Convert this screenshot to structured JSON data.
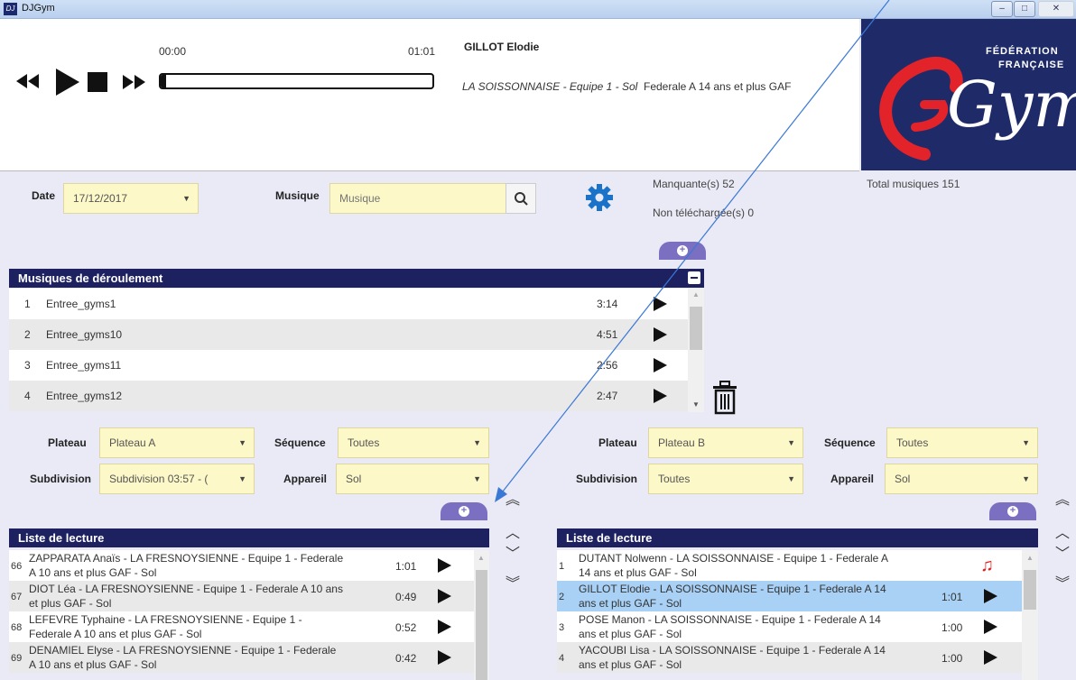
{
  "window": {
    "title": "DJGym",
    "minimize": "–",
    "maximize": "□",
    "close": "✕"
  },
  "player": {
    "current_time": "00:00",
    "duration": "01:01",
    "progress": 0.02,
    "artist": "GILLOT Elodie",
    "club_team": "LA SOISSONNAISE - Equipe 1 - Sol",
    "category": "Federale A 14 ans et plus GAF"
  },
  "logo": {
    "line1": "FÉDÉRATION",
    "line2": "FRANÇAISE",
    "word": "Gym"
  },
  "filters": {
    "date_label": "Date",
    "date_value": "17/12/2017",
    "music_label": "Musique",
    "music_placeholder": "Musique",
    "missing": "Manquante(s) 52",
    "not_downloaded": "Non téléchargée(s) 0",
    "total": "Total musiques 151"
  },
  "deroulement": {
    "title": "Musiques de déroulement",
    "rows": [
      {
        "num": "1",
        "name": "Entree_gyms1",
        "duration": "3:14"
      },
      {
        "num": "2",
        "name": "Entree_gyms10",
        "duration": "4:51"
      },
      {
        "num": "3",
        "name": "Entree_gyms11",
        "duration": "2:56"
      },
      {
        "num": "4",
        "name": "Entree_gyms12",
        "duration": "2:47"
      }
    ]
  },
  "left": {
    "plateau_label": "Plateau",
    "plateau_value": "Plateau A",
    "sequence_label": "Séquence",
    "sequence_value": "Toutes",
    "subdivision_label": "Subdivision",
    "subdivision_value": "Subdivision 03:57 - (",
    "appareil_label": "Appareil",
    "appareil_value": "Sol",
    "list_title": "Liste de lecture",
    "rows": [
      {
        "num": "66",
        "l1": "ZAPPARATA Anaïs - LA FRESNOYSIENNE - Equipe 1 - Federale",
        "l2": "A 10 ans et plus GAF - Sol",
        "duration": "1:01"
      },
      {
        "num": "67",
        "l1": "DIOT Léa - LA FRESNOYSIENNE - Equipe 1 - Federale A 10 ans",
        "l2": "et plus GAF - Sol",
        "duration": "0:49"
      },
      {
        "num": "68",
        "l1": "LEFEVRE Typhaine - LA FRESNOYSIENNE - Equipe 1 -",
        "l2": "Federale A 10 ans et plus GAF - Sol",
        "duration": "0:52"
      },
      {
        "num": "69",
        "l1": "DENAMIEL Elyse - LA FRESNOYSIENNE - Equipe 1 - Federale",
        "l2": "A 10 ans et plus GAF - Sol",
        "duration": "0:42"
      }
    ]
  },
  "right": {
    "plateau_label": "Plateau",
    "plateau_value": "Plateau B",
    "sequence_label": "Séquence",
    "sequence_value": "Toutes",
    "subdivision_label": "Subdivision",
    "subdivision_value": "Toutes",
    "appareil_label": "Appareil",
    "appareil_value": "Sol",
    "list_title": "Liste de lecture",
    "rows": [
      {
        "num": "1",
        "l1": "DUTANT Nolwenn - LA SOISSONNAISE - Equipe 1 - Federale A",
        "l2": "14 ans et plus GAF - Sol",
        "duration": ""
      },
      {
        "num": "2",
        "l1": "GILLOT Elodie - LA SOISSONNAISE - Equipe 1 - Federale A 14",
        "l2": "ans et plus GAF - Sol",
        "duration": "1:01"
      },
      {
        "num": "3",
        "l1": "POSE Manon - LA SOISSONNAISE - Equipe 1 - Federale A 14",
        "l2": "ans et plus GAF - Sol",
        "duration": "1:00"
      },
      {
        "num": "4",
        "l1": "YACOUBI Lisa - LA SOISSONNAISE - Equipe 1 - Federale A 14",
        "l2": "ans et plus GAF - Sol",
        "duration": "1:00"
      }
    ]
  },
  "colors": {
    "accent": "#7a6fc0",
    "header": "#1e2160",
    "selected_row": "#a8d1f5",
    "input_bg": "#fdf8c8",
    "gear": "#1a73c8",
    "missing_icon": "#e02020"
  }
}
